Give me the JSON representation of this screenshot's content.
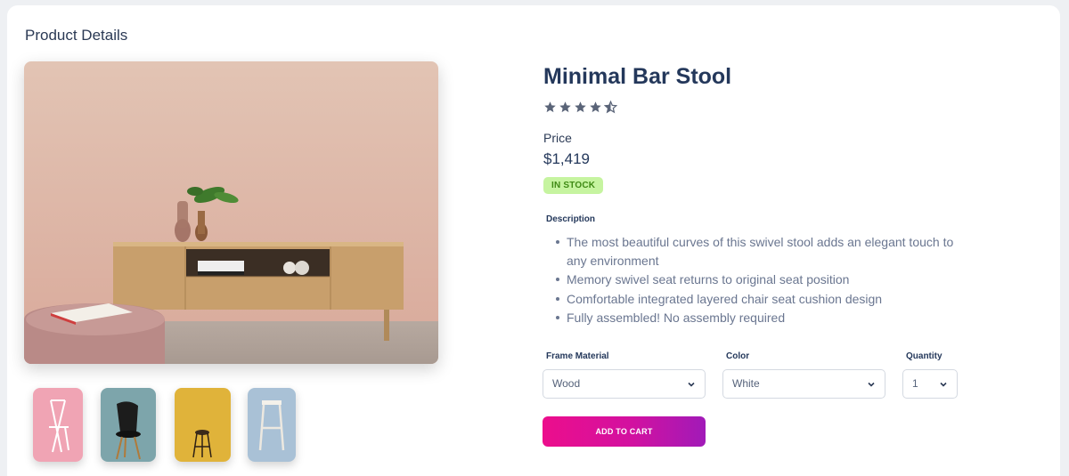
{
  "section_title": "Product Details",
  "product": {
    "title": "Minimal Bar Stool",
    "rating": 4.5,
    "rating_max": 5,
    "price_label": "Price",
    "price": "$1,419",
    "stock_badge": "IN STOCK",
    "description_label": "Description",
    "description": [
      "The most beautiful curves of this swivel stool adds an elegant touch to any environment",
      "Memory swivel seat returns to original seat position",
      "Comfortable integrated layered chair seat cushion design",
      "Fully assembled! No assembly required"
    ]
  },
  "options": {
    "frame_material": {
      "label": "Frame Material",
      "value": "Wood"
    },
    "color": {
      "label": "Color",
      "value": "White"
    },
    "quantity": {
      "label": "Quantity",
      "value": "1"
    }
  },
  "cart_button": "ADD TO CART",
  "colors": {
    "title": "#24385b",
    "badge_bg": "#c6f4a0",
    "badge_text": "#3f8a14",
    "button_gradient_start": "#ec0e8c",
    "button_gradient_end": "#a11ab8",
    "star": "#5a6478"
  },
  "thumbnails": [
    {
      "name": "pink folding chair",
      "bg": "#f0a4b4"
    },
    {
      "name": "black shell chair",
      "bg": "#7da5ab"
    },
    {
      "name": "wooden bar stool",
      "bg": "#e0b33a"
    },
    {
      "name": "white wooden stool",
      "bg": "#a9c1d6"
    }
  ]
}
